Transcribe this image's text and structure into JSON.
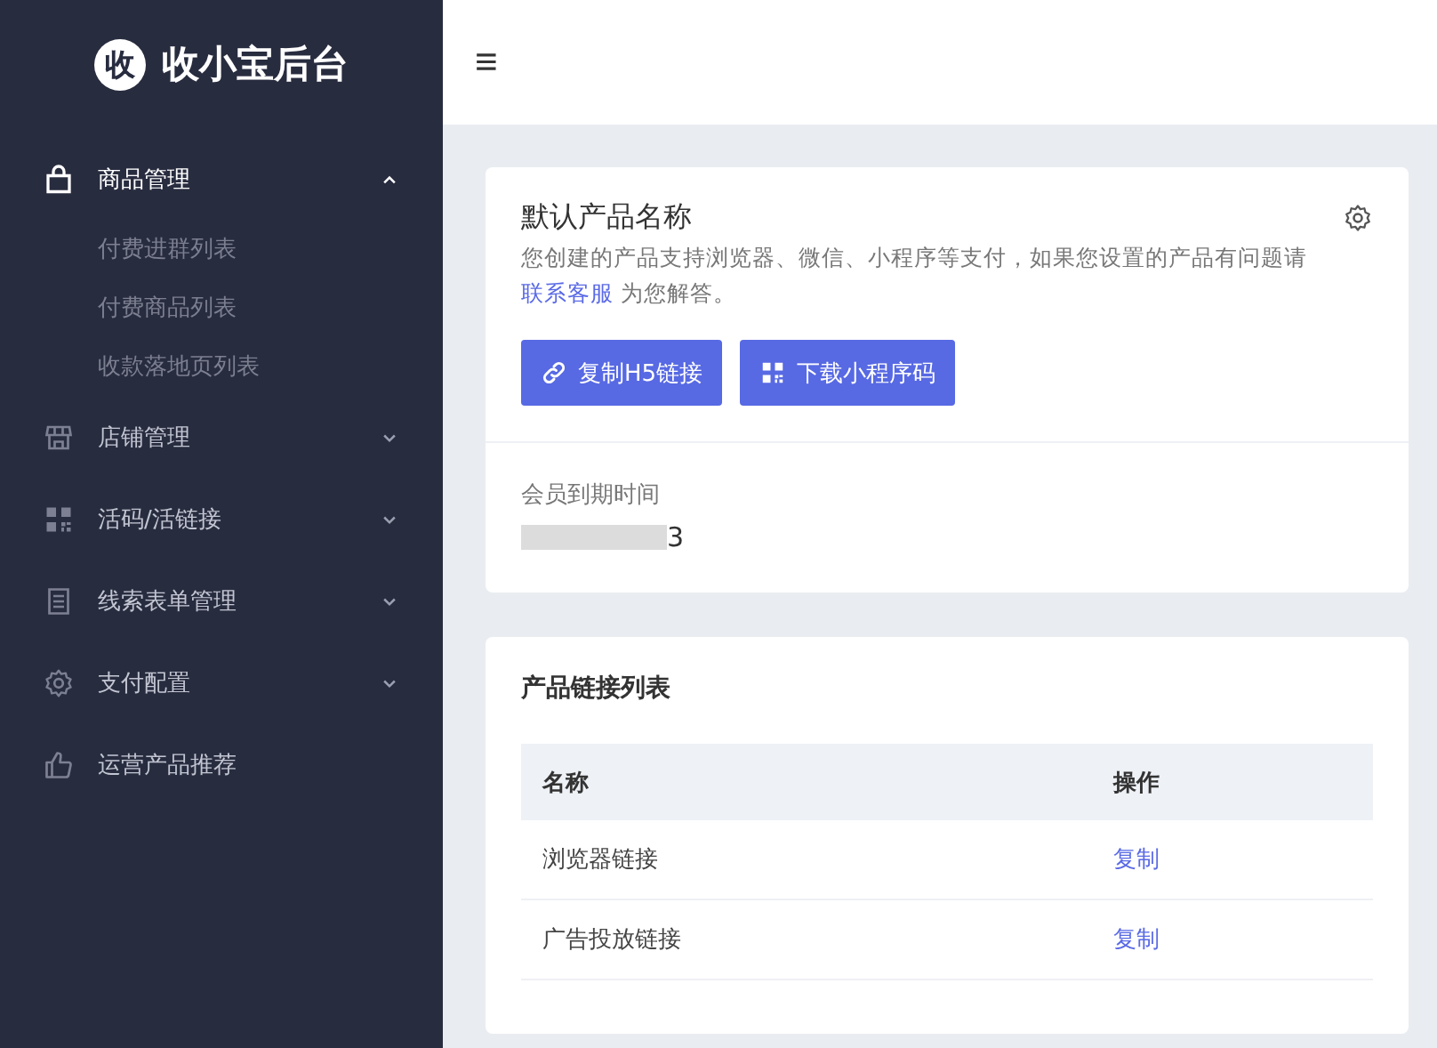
{
  "brand": {
    "logo_char": "收",
    "title": "收小宝后台"
  },
  "sidebar": {
    "items": [
      {
        "label": "商品管理",
        "kind": "group",
        "selected": true,
        "expanded": true,
        "children": [
          {
            "label": "付费进群列表"
          },
          {
            "label": "付费商品列表"
          },
          {
            "label": "收款落地页列表"
          }
        ]
      },
      {
        "label": "店铺管理",
        "kind": "group",
        "selected": false,
        "expanded": false
      },
      {
        "label": "活码/活链接",
        "kind": "group",
        "selected": false,
        "expanded": false
      },
      {
        "label": "线索表单管理",
        "kind": "group",
        "selected": false,
        "expanded": false
      },
      {
        "label": "支付配置",
        "kind": "group",
        "selected": false,
        "expanded": false
      },
      {
        "label": "运营产品推荐",
        "kind": "link",
        "selected": false
      }
    ]
  },
  "header": {
    "menu_toggle": "≡"
  },
  "product_card": {
    "title": "默认产品名称",
    "description": "您创建的产品支持浏览器、微信、小程序等支付，如果您设置的产品有问题请",
    "link": "联系客服",
    "description_end": "为您解答。",
    "buttons": [
      {
        "label": "复制H5链接",
        "kind": "link"
      },
      {
        "label": "下载小程序码",
        "kind": "qr"
      }
    ],
    "expiry_label": "会员到期时间",
    "expiry_value": "3"
  },
  "links_card": {
    "title": "产品链接列表",
    "columns": [
      "名称",
      "操作"
    ],
    "rows": [
      {
        "name": "浏览器链接",
        "action": "复制"
      },
      {
        "name": "广告投放链接",
        "action": "复制"
      }
    ]
  }
}
